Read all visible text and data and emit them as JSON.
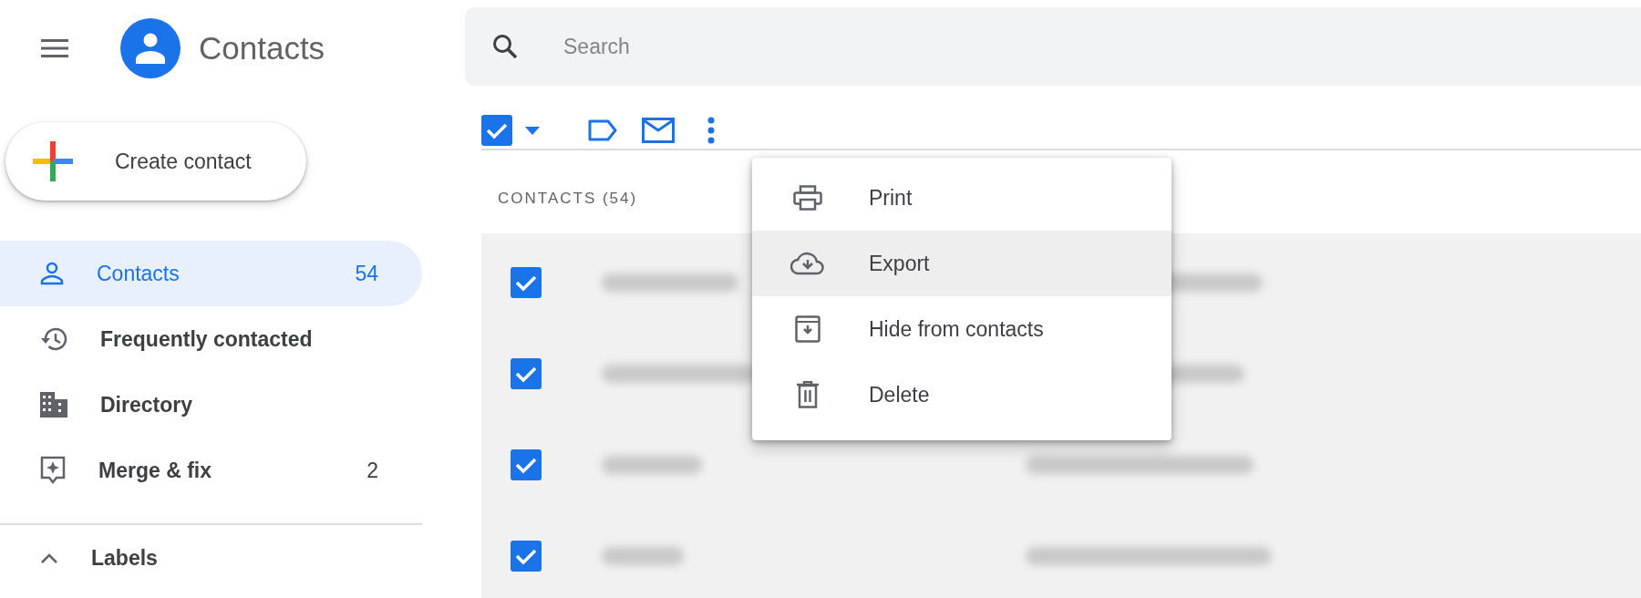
{
  "app": {
    "title": "Contacts"
  },
  "create_button": {
    "label": "Create contact"
  },
  "sidebar": {
    "items": [
      {
        "kind": "person",
        "label": "Contacts",
        "count": "54",
        "selected": true
      },
      {
        "kind": "history",
        "label": "Frequently contacted",
        "selected": false
      },
      {
        "kind": "building",
        "label": "Directory",
        "selected": false
      },
      {
        "kind": "merge",
        "label": "Merge & fix",
        "count": "2",
        "selected": false
      }
    ],
    "labels_section": {
      "label": "Labels",
      "expanded": true
    }
  },
  "search": {
    "placeholder": "Search"
  },
  "toolbar": {
    "select_all_checked": true
  },
  "list": {
    "heading": "CONTACTS (54)",
    "rows": [
      {
        "checked": true
      },
      {
        "checked": true
      },
      {
        "checked": true
      },
      {
        "checked": true
      }
    ]
  },
  "menu": {
    "items": [
      {
        "kind": "print",
        "label": "Print",
        "selected": false
      },
      {
        "kind": "export",
        "label": "Export",
        "selected": true
      },
      {
        "kind": "hide",
        "label": "Hide from contacts",
        "selected": false
      },
      {
        "kind": "delete",
        "label": "Delete",
        "selected": false
      }
    ]
  }
}
